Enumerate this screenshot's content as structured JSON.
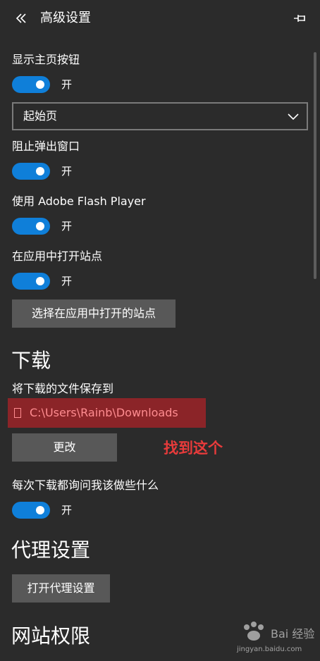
{
  "header": {
    "title": "高级设置",
    "back_icon": "double-chevron-left-icon",
    "pin_icon": "pin-icon"
  },
  "settings": {
    "show_home_button": {
      "label": "显示主页按钮",
      "state": "开"
    },
    "home_select": {
      "value": "起始页"
    },
    "block_popups": {
      "label": "阻止弹出窗口",
      "state": "开"
    },
    "flash_player": {
      "label": "使用 Adobe Flash Player",
      "state": "开"
    },
    "open_sites_in_apps": {
      "label": "在应用中打开站点",
      "state": "开"
    },
    "choose_sites_button": "选择在应用中打开的站点"
  },
  "downloads": {
    "section_title": "下载",
    "save_to_label": "将下载的文件保存到",
    "path": "C:\\Users\\Rainb\\Downloads",
    "change_button": "更改",
    "annotation": "找到这个",
    "ask_each_time": {
      "label": "每次下载都询问我该做些什么",
      "state": "开"
    }
  },
  "proxy": {
    "section_title": "代理设置",
    "open_button": "打开代理设置"
  },
  "permissions": {
    "section_title": "网站权限"
  },
  "watermark": {
    "brand": "Bai 经验",
    "url": "jingyan.baidu.com"
  },
  "colors": {
    "background": "#2b2b2b",
    "toggle_on": "#0f7fd9",
    "button": "#585858",
    "highlight_box": "#8b2428",
    "highlight_text": "#ff8c90",
    "annotation": "#e83b3b"
  }
}
